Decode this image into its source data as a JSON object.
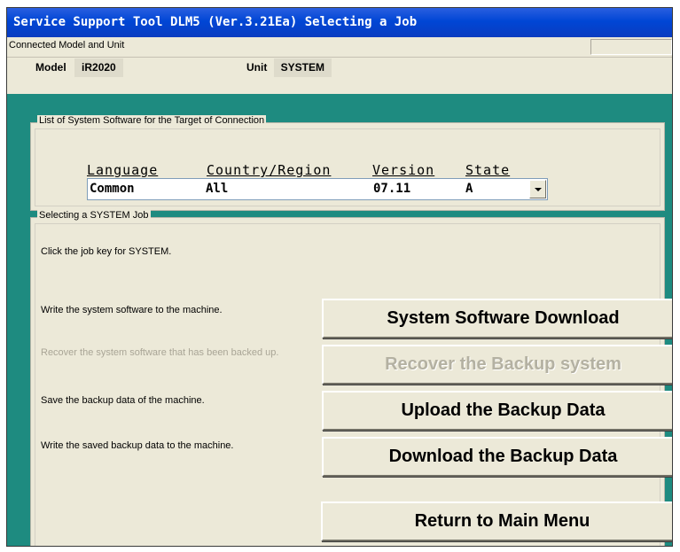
{
  "window": {
    "title": "Service Support Tool DLM5 (Ver.3.21Ea) Selecting a Job"
  },
  "connection": {
    "group_label": "Connected Model and Unit",
    "model_label": "Model",
    "model_value": "iR2020",
    "unit_label": "Unit",
    "unit_value": "SYSTEM"
  },
  "software_list": {
    "group_label": "List of System Software for the Target of Connection",
    "columns": [
      "Language",
      "Country/Region",
      "Version",
      "State"
    ],
    "selected_row": {
      "language": "Common",
      "country": "All",
      "version": "07.11",
      "state": "A"
    }
  },
  "job": {
    "group_label": "Selecting a SYSTEM Job",
    "instruction": "Click the job key for SYSTEM.",
    "items": [
      {
        "description": "Write the system software to the machine.",
        "button": "System Software Download",
        "enabled": true
      },
      {
        "description": "Recover the system software that has been backed up.",
        "button": "Recover the Backup system",
        "enabled": false
      },
      {
        "description": "Save the backup data of the machine.",
        "button": "Upload the Backup Data",
        "enabled": true
      },
      {
        "description": "Write the saved backup data to the machine.",
        "button": "Download the Backup Data",
        "enabled": true
      }
    ],
    "return_button": "Return to Main Menu"
  },
  "colors": {
    "background": "#1e8b80",
    "title_bar": "#0046d5",
    "panel": "#ece9d8",
    "disabled_text": "#a9a596"
  }
}
